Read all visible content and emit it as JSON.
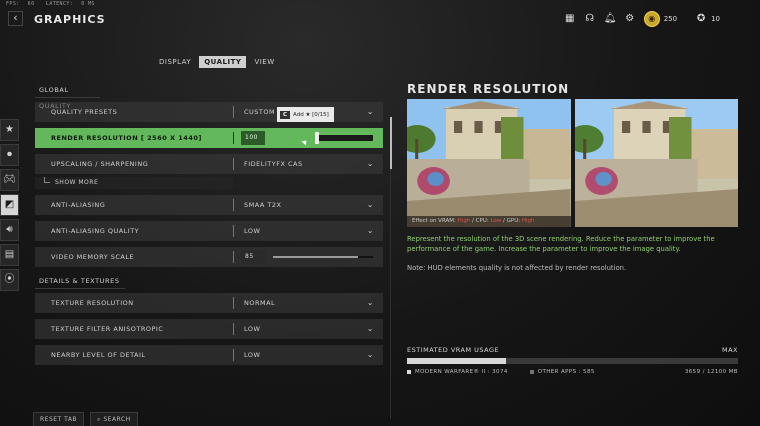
{
  "top": {
    "fps_label": "FPS:",
    "fps_value": "60",
    "latency_label": "LATENCY:",
    "latency_value": "0 MS",
    "title": "GRAPHICS",
    "points": "250",
    "players": "10"
  },
  "tabs": [
    {
      "label": "DISPLAY"
    },
    {
      "label": "QUALITY"
    },
    {
      "label": "VIEW"
    }
  ],
  "sections": {
    "global": "GLOBAL QUALITY",
    "details": "DETAILS & TEXTURES"
  },
  "settings": {
    "quality_presets": {
      "label": "QUALITY PRESETS",
      "value": "CUSTOM"
    },
    "render_resolution": {
      "label": "RENDER RESOLUTION [ 2560 X 1440]",
      "value": "100",
      "fraction": 0.42
    },
    "upscaling": {
      "label": "UPSCALING / SHARPENING",
      "value": "FIDELITYFX CAS"
    },
    "show_more": "SHOW MORE",
    "anti_aliasing": {
      "label": "ANTI-ALIASING",
      "value": "SMAA T2X"
    },
    "aa_quality": {
      "label": "ANTI-ALIASING QUALITY",
      "value": "LOW"
    },
    "video_memory": {
      "label": "VIDEO MEMORY SCALE",
      "value": "85",
      "fraction": 0.85
    },
    "texture_resolution": {
      "label": "TEXTURE RESOLUTION",
      "value": "NORMAL"
    },
    "texture_filter": {
      "label": "TEXTURE FILTER ANISOTROPIC",
      "value": "LOW"
    },
    "nearby_lod": {
      "label": "NEARBY LEVEL OF DETAIL",
      "value": "LOW"
    }
  },
  "tooltip": {
    "key": "C",
    "text": "Add ★ [0/15]"
  },
  "right": {
    "title": "RENDER RESOLUTION",
    "caption": {
      "prefix": "Effect on VRAM:",
      "vram": "High",
      "cpu_label": "/ CPU:",
      "cpu": "Low",
      "gpu_label": "/ GPU:",
      "gpu": "High"
    },
    "description": "Represent the resolution of the 3D scene rendering. Reduce the parameter to improve the performance of the game. Increase the parameter to improve the image quality.",
    "note": "Note: HUD elements quality is not affected by render resolution."
  },
  "vram": {
    "title": "ESTIMATED VRAM USAGE",
    "max": "MAX",
    "mw_label": "MODERN WARFARE® II : 3074",
    "other_label": "OTHER APPS : 585",
    "total": "3659 / 12100 MB",
    "used_fraction": 0.3
  },
  "bottom": {
    "reset": "RESET TAB",
    "search": "SEARCH"
  },
  "colors": {
    "accent_green": "#62b85a",
    "desc_green": "#8fd16f",
    "warn_red": "#e05050"
  }
}
